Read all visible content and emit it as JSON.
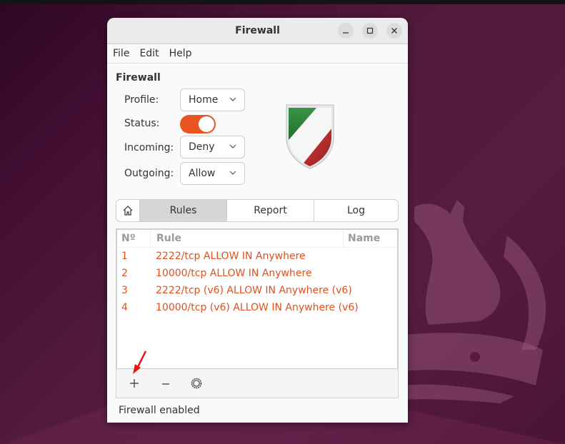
{
  "window": {
    "title": "Firewall",
    "controls": [
      "minimize",
      "maximize",
      "close"
    ]
  },
  "menu": {
    "items": [
      "File",
      "Edit",
      "Help"
    ]
  },
  "firewall": {
    "section_title": "Firewall",
    "profile_label": "Profile:",
    "profile_value": "Home",
    "status_label": "Status:",
    "status_on": true,
    "incoming_label": "Incoming:",
    "incoming_value": "Deny",
    "outgoing_label": "Outgoing:",
    "outgoing_value": "Allow",
    "accent_color": "#e95420"
  },
  "tabs": {
    "home_icon": "home-icon",
    "items": [
      "Rules",
      "Report",
      "Log"
    ],
    "active": "Rules"
  },
  "rules": {
    "columns": [
      "Nº",
      "Rule",
      "Name"
    ],
    "rows": [
      {
        "no": "1",
        "rule": "2222/tcp ALLOW IN Anywhere",
        "name": ""
      },
      {
        "no": "2",
        "rule": "10000/tcp ALLOW IN Anywhere",
        "name": ""
      },
      {
        "no": "3",
        "rule": "2222/tcp (v6) ALLOW IN Anywhere (v6)",
        "name": ""
      },
      {
        "no": "4",
        "rule": "10000/tcp (v6) ALLOW IN Anywhere (v6)",
        "name": ""
      }
    ],
    "row_color": "#e0501c",
    "footer_buttons": [
      "add",
      "remove",
      "settings"
    ]
  },
  "statusbar": {
    "text": "Firewall enabled"
  }
}
